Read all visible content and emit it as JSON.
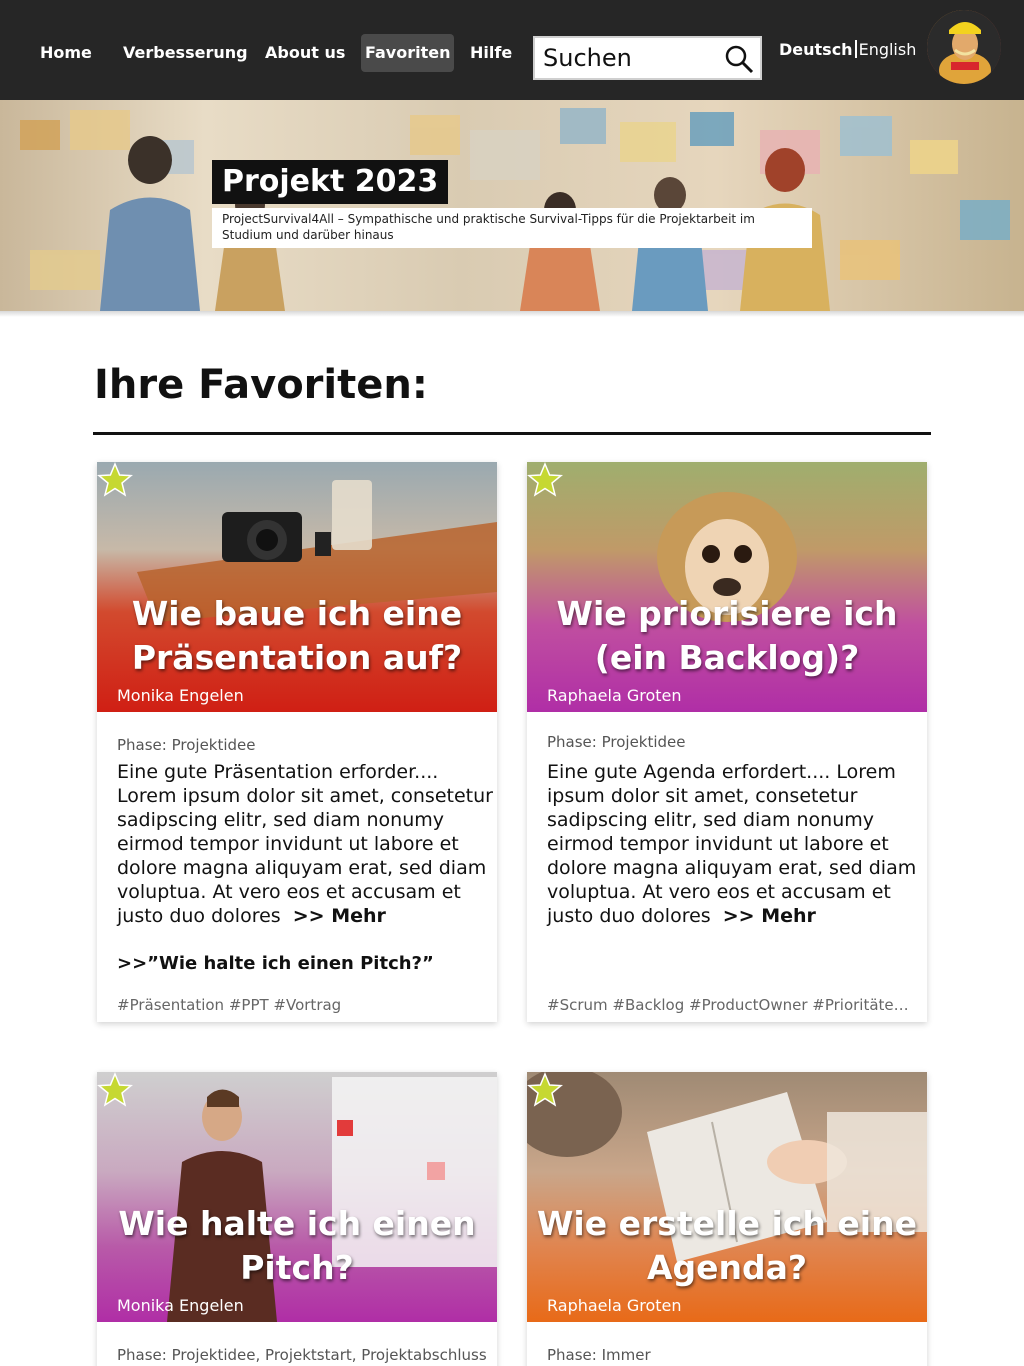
{
  "nav": {
    "items": [
      {
        "label": "Home"
      },
      {
        "label": "Verbesserung"
      },
      {
        "label": "About us"
      },
      {
        "label": "Favoriten"
      },
      {
        "label": "Hilfe"
      }
    ],
    "active": "Favoriten",
    "search_placeholder": "Suchen",
    "search_icon": "search-icon",
    "lang_de": "Deutsch",
    "lang_en": "English"
  },
  "hero": {
    "title": "Projekt 2023",
    "subtitle": "ProjectSurvival4All – Sympathische und praktische Survival-Tipps für die Projektarbeit im Studium und darüber hinaus"
  },
  "page": {
    "heading": "Ihre Favoriten:"
  },
  "cards": [
    {
      "title": "Wie baue ich eine Präsentation auf?",
      "author": "Monika Engelen",
      "phase": "Phase: Projektidee",
      "text": "Eine gute Präsentation erforder.... Lorem ipsum dolor sit amet, consetetur sadipscing elitr, sed diam nonumy eirmod tempor invidunt ut labore et dolore magna aliquyam erat, sed diam voluptua. At vero eos et accusam et justo duo dolores",
      "more": ">> Mehr",
      "link": ">>”Wie halte ich einen Pitch?”",
      "tags": "#Präsentation #PPT #Vortrag",
      "accent": "#d32f1e"
    },
    {
      "title": "Wie priorisiere ich (ein Backlog)?",
      "author": "Raphaela Groten",
      "phase": "Phase: Projektidee",
      "text": "Eine gute Agenda erfordert.... Lorem ipsum dolor sit amet, consetetur sadipscing elitr, sed diam nonumy eirmod tempor invidunt ut labore et dolore magna aliquyam erat, sed diam voluptua. At vero eos et accusam et justo duo dolores",
      "more": ">> Mehr",
      "link": "",
      "tags": "#Scrum #Backlog #ProductOwner #Prioritäten ...",
      "accent": "#b230a4"
    },
    {
      "title": "Wie halte ich einen Pitch?",
      "author": "Monika Engelen",
      "phase": "Phase: Projektidee, Projektstart, Projektabschluss",
      "accent": "#b230a4"
    },
    {
      "title": "Wie erstelle ich eine Agenda?",
      "author": "Raphaela Groten",
      "phase": "Phase: Immer",
      "accent": "#e86a18"
    }
  ]
}
